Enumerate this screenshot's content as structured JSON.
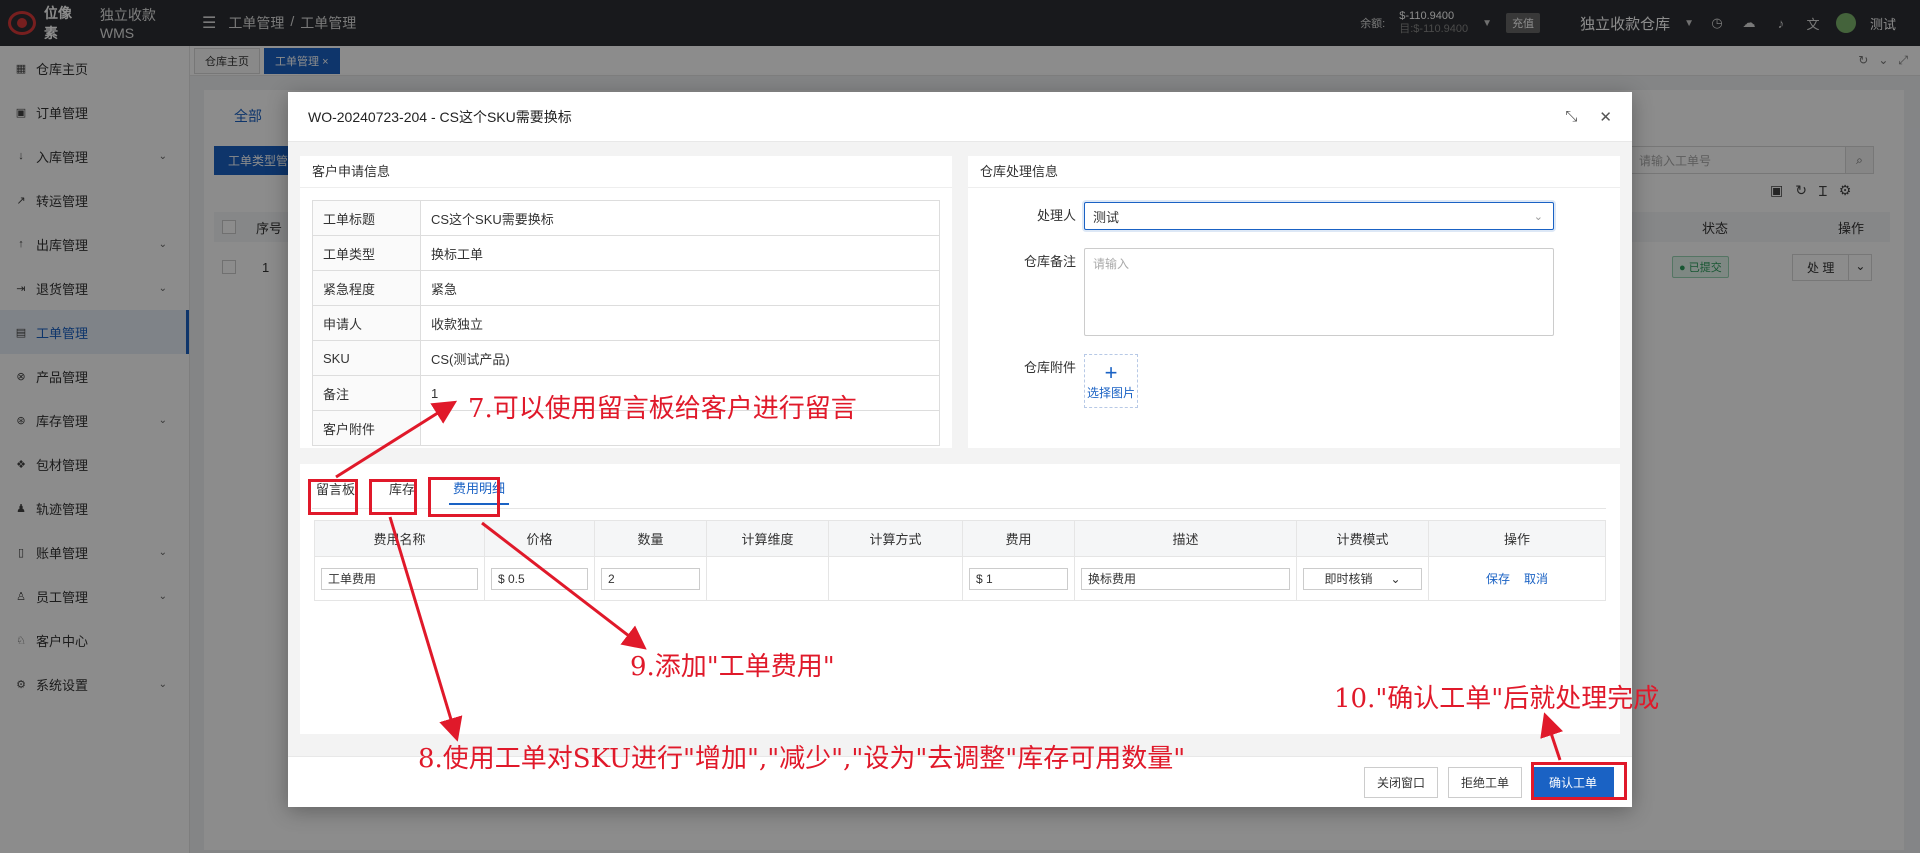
{
  "app": {
    "logo_text": "位像素",
    "brand": "独立收款WMS",
    "breadcrumb": [
      "工单管理",
      "/",
      "工单管理"
    ],
    "balance_label": "余额:",
    "balance_main": "$-110.9400",
    "balance_sub": "目:$-110.9400",
    "recharge": "充值",
    "warehouse": "独立收款仓库",
    "user": "测试"
  },
  "sidebar": {
    "items": [
      {
        "label": "仓库主页",
        "icon": "grid-icon"
      },
      {
        "label": "订单管理",
        "icon": "order-icon"
      },
      {
        "label": "入库管理",
        "icon": "inbound-icon",
        "expand": true
      },
      {
        "label": "转运管理",
        "icon": "transfer-icon"
      },
      {
        "label": "出库管理",
        "icon": "outbound-icon",
        "expand": true
      },
      {
        "label": "退货管理",
        "icon": "return-icon",
        "expand": true
      },
      {
        "label": "工单管理",
        "icon": "ticket-icon",
        "active": true
      },
      {
        "label": "产品管理",
        "icon": "product-icon"
      },
      {
        "label": "库存管理",
        "icon": "inventory-icon",
        "expand": true
      },
      {
        "label": "包材管理",
        "icon": "package-icon"
      },
      {
        "label": "轨迹管理",
        "icon": "track-icon"
      },
      {
        "label": "账单管理",
        "icon": "bill-icon",
        "expand": true
      },
      {
        "label": "员工管理",
        "icon": "staff-icon",
        "expand": true
      },
      {
        "label": "客户中心",
        "icon": "customer-icon"
      },
      {
        "label": "系统设置",
        "icon": "settings-icon",
        "expand": true
      }
    ]
  },
  "page_tabs": [
    "仓库主页",
    "工单管理"
  ],
  "background": {
    "tab_all": "全部",
    "btn_type": "工单类型管",
    "search_placeholder": "请输入工单号",
    "col_index": "序号",
    "col_status": "状态",
    "col_action": "操作",
    "row_index": "1",
    "row_status": "已提交",
    "row_action": "处 理"
  },
  "modal": {
    "title": "WO-20240723-204 - CS这个SKU需要换标",
    "customer_panel": {
      "title": "客户申请信息",
      "rows": [
        {
          "k": "工单标题",
          "v": "CS这个SKU需要换标"
        },
        {
          "k": "工单类型",
          "v": "换标工单"
        },
        {
          "k": "紧急程度",
          "v": "紧急"
        },
        {
          "k": "申请人",
          "v": "收款独立"
        },
        {
          "k": "SKU",
          "v": "CS(测试产品)"
        },
        {
          "k": "备注",
          "v": "1"
        },
        {
          "k": "客户附件",
          "v": ""
        }
      ]
    },
    "warehouse_panel": {
      "title": "仓库处理信息",
      "handler_label": "处理人",
      "handler_value": "测试",
      "remark_label": "仓库备注",
      "remark_placeholder": "请输入",
      "attach_label": "仓库附件",
      "upload_text": "选择图片"
    },
    "tabs": [
      "留言板",
      "库存",
      "费用明细"
    ],
    "fee_table": {
      "headers": [
        "费用名称",
        "价格",
        "数量",
        "计算维度",
        "计算方式",
        "费用",
        "描述",
        "计费模式",
        "操作"
      ],
      "row": {
        "name": "工单费用",
        "price": "$ 0.5",
        "qty": "2",
        "dimension": "",
        "method": "",
        "fee": "$ 1",
        "desc": "换标费用",
        "mode": "即时核销",
        "save": "保存",
        "cancel": "取消"
      }
    },
    "footer": {
      "close": "关闭窗口",
      "reject": "拒绝工单",
      "confirm": "确认工单"
    }
  },
  "annotations": {
    "note7": "7.可以使用留言板给客户进行留言",
    "note8": "8.使用工单对SKU进行\"增加\",\"减少\",\"设为\"去调整\"库存可用数量\"",
    "note9": "9.添加\"工单费用\"",
    "note10": "10.\"确认工单\"后就处理完成",
    "color": "#e0192a"
  }
}
